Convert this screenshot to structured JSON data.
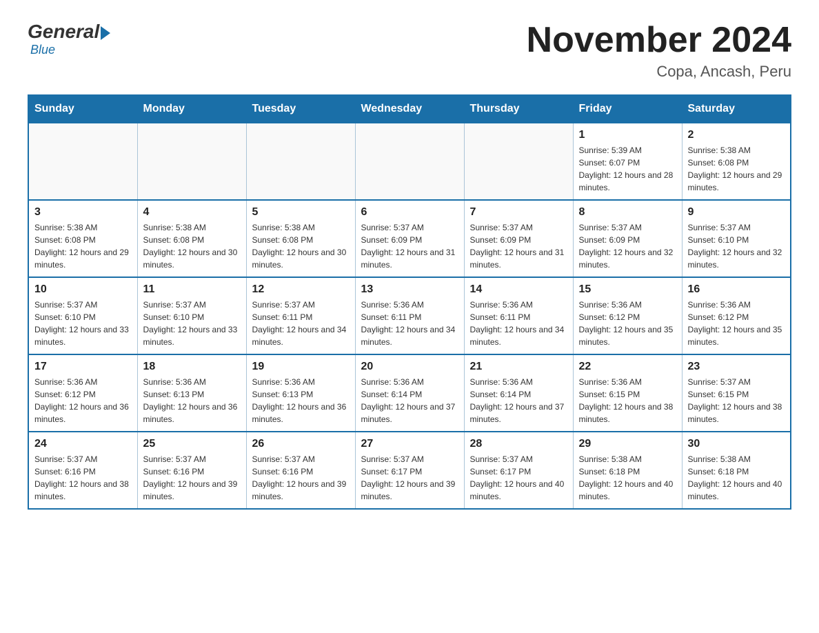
{
  "logo": {
    "general": "General",
    "blue": "Blue"
  },
  "header": {
    "month": "November 2024",
    "location": "Copa, Ancash, Peru"
  },
  "days_of_week": [
    "Sunday",
    "Monday",
    "Tuesday",
    "Wednesday",
    "Thursday",
    "Friday",
    "Saturday"
  ],
  "weeks": [
    [
      {
        "day": "",
        "info": ""
      },
      {
        "day": "",
        "info": ""
      },
      {
        "day": "",
        "info": ""
      },
      {
        "day": "",
        "info": ""
      },
      {
        "day": "",
        "info": ""
      },
      {
        "day": "1",
        "info": "Sunrise: 5:39 AM\nSunset: 6:07 PM\nDaylight: 12 hours and 28 minutes."
      },
      {
        "day": "2",
        "info": "Sunrise: 5:38 AM\nSunset: 6:08 PM\nDaylight: 12 hours and 29 minutes."
      }
    ],
    [
      {
        "day": "3",
        "info": "Sunrise: 5:38 AM\nSunset: 6:08 PM\nDaylight: 12 hours and 29 minutes."
      },
      {
        "day": "4",
        "info": "Sunrise: 5:38 AM\nSunset: 6:08 PM\nDaylight: 12 hours and 30 minutes."
      },
      {
        "day": "5",
        "info": "Sunrise: 5:38 AM\nSunset: 6:08 PM\nDaylight: 12 hours and 30 minutes."
      },
      {
        "day": "6",
        "info": "Sunrise: 5:37 AM\nSunset: 6:09 PM\nDaylight: 12 hours and 31 minutes."
      },
      {
        "day": "7",
        "info": "Sunrise: 5:37 AM\nSunset: 6:09 PM\nDaylight: 12 hours and 31 minutes."
      },
      {
        "day": "8",
        "info": "Sunrise: 5:37 AM\nSunset: 6:09 PM\nDaylight: 12 hours and 32 minutes."
      },
      {
        "day": "9",
        "info": "Sunrise: 5:37 AM\nSunset: 6:10 PM\nDaylight: 12 hours and 32 minutes."
      }
    ],
    [
      {
        "day": "10",
        "info": "Sunrise: 5:37 AM\nSunset: 6:10 PM\nDaylight: 12 hours and 33 minutes."
      },
      {
        "day": "11",
        "info": "Sunrise: 5:37 AM\nSunset: 6:10 PM\nDaylight: 12 hours and 33 minutes."
      },
      {
        "day": "12",
        "info": "Sunrise: 5:37 AM\nSunset: 6:11 PM\nDaylight: 12 hours and 34 minutes."
      },
      {
        "day": "13",
        "info": "Sunrise: 5:36 AM\nSunset: 6:11 PM\nDaylight: 12 hours and 34 minutes."
      },
      {
        "day": "14",
        "info": "Sunrise: 5:36 AM\nSunset: 6:11 PM\nDaylight: 12 hours and 34 minutes."
      },
      {
        "day": "15",
        "info": "Sunrise: 5:36 AM\nSunset: 6:12 PM\nDaylight: 12 hours and 35 minutes."
      },
      {
        "day": "16",
        "info": "Sunrise: 5:36 AM\nSunset: 6:12 PM\nDaylight: 12 hours and 35 minutes."
      }
    ],
    [
      {
        "day": "17",
        "info": "Sunrise: 5:36 AM\nSunset: 6:12 PM\nDaylight: 12 hours and 36 minutes."
      },
      {
        "day": "18",
        "info": "Sunrise: 5:36 AM\nSunset: 6:13 PM\nDaylight: 12 hours and 36 minutes."
      },
      {
        "day": "19",
        "info": "Sunrise: 5:36 AM\nSunset: 6:13 PM\nDaylight: 12 hours and 36 minutes."
      },
      {
        "day": "20",
        "info": "Sunrise: 5:36 AM\nSunset: 6:14 PM\nDaylight: 12 hours and 37 minutes."
      },
      {
        "day": "21",
        "info": "Sunrise: 5:36 AM\nSunset: 6:14 PM\nDaylight: 12 hours and 37 minutes."
      },
      {
        "day": "22",
        "info": "Sunrise: 5:36 AM\nSunset: 6:15 PM\nDaylight: 12 hours and 38 minutes."
      },
      {
        "day": "23",
        "info": "Sunrise: 5:37 AM\nSunset: 6:15 PM\nDaylight: 12 hours and 38 minutes."
      }
    ],
    [
      {
        "day": "24",
        "info": "Sunrise: 5:37 AM\nSunset: 6:16 PM\nDaylight: 12 hours and 38 minutes."
      },
      {
        "day": "25",
        "info": "Sunrise: 5:37 AM\nSunset: 6:16 PM\nDaylight: 12 hours and 39 minutes."
      },
      {
        "day": "26",
        "info": "Sunrise: 5:37 AM\nSunset: 6:16 PM\nDaylight: 12 hours and 39 minutes."
      },
      {
        "day": "27",
        "info": "Sunrise: 5:37 AM\nSunset: 6:17 PM\nDaylight: 12 hours and 39 minutes."
      },
      {
        "day": "28",
        "info": "Sunrise: 5:37 AM\nSunset: 6:17 PM\nDaylight: 12 hours and 40 minutes."
      },
      {
        "day": "29",
        "info": "Sunrise: 5:38 AM\nSunset: 6:18 PM\nDaylight: 12 hours and 40 minutes."
      },
      {
        "day": "30",
        "info": "Sunrise: 5:38 AM\nSunset: 6:18 PM\nDaylight: 12 hours and 40 minutes."
      }
    ]
  ]
}
